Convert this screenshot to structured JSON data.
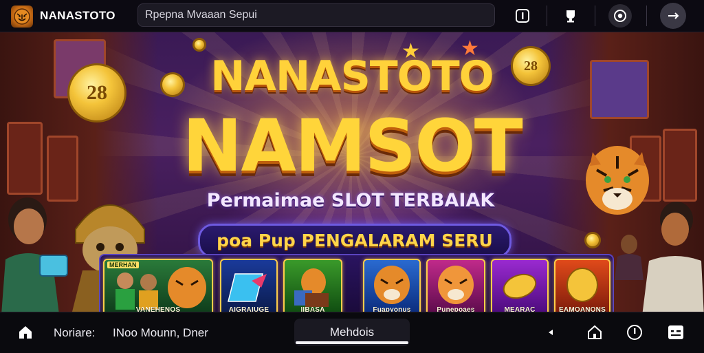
{
  "header": {
    "brand": "NANASTOTO",
    "logo_icon": "tiger-logo-icon",
    "search_placeholder": "Rpepna Mvaaan Sepui",
    "icons": [
      "info-box-icon",
      "trophy-icon",
      "eye-icon",
      "arrow-right-icon"
    ]
  },
  "hero": {
    "title_line1": "NANASTOTO",
    "title_line2": "NAMSOT",
    "subtitle": "Permaimae SLOT TERBAIAK",
    "banner": "poa Pup PENGALARAM SERU",
    "coins": [
      "28",
      "28"
    ],
    "accent_color": "#ffd23a",
    "banner_border_color": "#6e5ae0",
    "game_cards": [
      {
        "top_label": "MERHAN",
        "label": "VANEHENOS",
        "theme": "boys-tiger"
      },
      {
        "label": "AIGRAIUGE",
        "theme": "blue-crystal"
      },
      {
        "label": "IIBASA",
        "theme": "tiger-reader"
      },
      {
        "label": "Fuapyonus",
        "theme": "tiger-blue"
      },
      {
        "label": "Punepoaes",
        "theme": "tiger-pink"
      },
      {
        "label": "MEARAC",
        "theme": "gold-coin-purple"
      },
      {
        "label": "EAMOANONS",
        "theme": "gold-coin-red"
      }
    ]
  },
  "footer": {
    "home_icon": "home-icon",
    "label_left": "Noriare:",
    "label_mid": "INoo Mounn, Dner",
    "active_tab": "Mehdois",
    "icons_right": [
      "arrow-left-icon",
      "home-outline-icon",
      "clock-icon",
      "chat-box-icon"
    ]
  }
}
